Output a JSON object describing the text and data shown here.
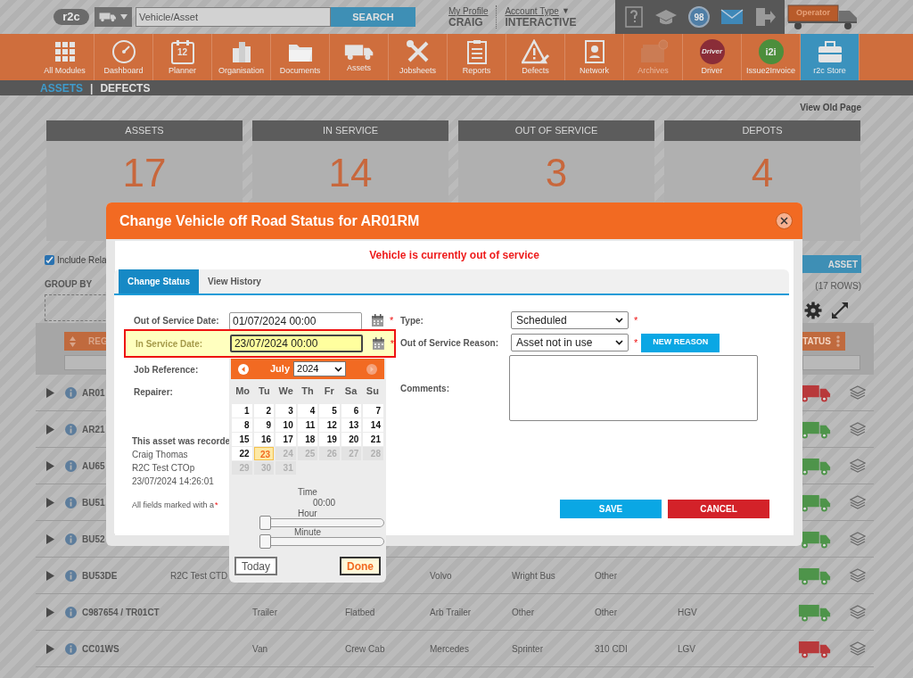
{
  "header": {
    "logo": "r2c",
    "search": {
      "placeholder": "Vehicle/Asset"
    },
    "search_button": "SEARCH",
    "profile": {
      "link": "My Profile",
      "name": "CRAIG"
    },
    "account": {
      "link": "Account Type",
      "caret": "▼",
      "value": "INTERACTIVE"
    },
    "tools": [
      {
        "kind": "help"
      },
      {
        "kind": "training"
      },
      {
        "kind": "badge",
        "text": "98"
      },
      {
        "kind": "mail"
      },
      {
        "kind": "logout"
      }
    ],
    "operator": "Operator"
  },
  "nav": [
    {
      "label": "All Modules",
      "kind": "grid",
      "selected": false,
      "disabled": false
    },
    {
      "label": "Dashboard",
      "kind": "gauge",
      "selected": false,
      "disabled": false
    },
    {
      "label": "Planner",
      "kind": "calendar",
      "icon_text": "12",
      "selected": false,
      "disabled": false
    },
    {
      "label": "Organisation",
      "kind": "building",
      "selected": false,
      "disabled": false
    },
    {
      "label": "Documents",
      "kind": "folder",
      "selected": false,
      "disabled": false
    },
    {
      "label": "Assets",
      "kind": "truck",
      "selected": false,
      "disabled": false
    },
    {
      "label": "Jobsheets",
      "kind": "tools",
      "selected": false,
      "disabled": false
    },
    {
      "label": "Reports",
      "kind": "clipboard",
      "selected": false,
      "disabled": false
    },
    {
      "label": "Defects",
      "kind": "warning",
      "selected": false,
      "disabled": false
    },
    {
      "label": "Network",
      "kind": "book",
      "selected": false,
      "disabled": false
    },
    {
      "label": "Archives",
      "kind": "archive",
      "selected": false,
      "disabled": true
    },
    {
      "label": "Driver",
      "kind": "driver",
      "icon_text": "Driver",
      "selected": false,
      "disabled": false
    },
    {
      "label": "Issue2Invoice",
      "kind": "i2i",
      "icon_text": "i2i",
      "selected": false,
      "disabled": false
    },
    {
      "label": "r2c Store",
      "kind": "store",
      "selected": true,
      "disabled": false
    }
  ],
  "subnav": {
    "items": [
      {
        "label": "ASSETS",
        "selected": true
      },
      {
        "label": "DEFECTS",
        "selected": false
      }
    ],
    "separator": "|"
  },
  "view_old_page": "View Old Page",
  "summary": [
    {
      "title": "ASSETS",
      "value": "17"
    },
    {
      "title": "IN SERVICE",
      "value": "14"
    },
    {
      "title": "OUT OF SERVICE",
      "value": "3"
    },
    {
      "title": "DEPOTS",
      "value": "4"
    }
  ],
  "toolbar": {
    "include": {
      "label": "Include Rela",
      "checked": true
    },
    "group_by": "GROUP BY",
    "add_button": "ASSET",
    "row_count": "(17 ROWS)"
  },
  "table": {
    "columns": [
      {
        "label": "REG"
      },
      {
        "label": "TATUS"
      }
    ],
    "rows": [
      {
        "reg": "AR01",
        "in_service": false
      },
      {
        "reg": "AR21",
        "in_service": true
      },
      {
        "reg": "AU65",
        "in_service": true
      },
      {
        "reg": "BU51",
        "in_service": true
      },
      {
        "reg": "BU52",
        "in_service": true
      },
      {
        "reg": "BU53DE",
        "owner": "R2C Test CTD",
        "make": "Volvo",
        "model": "Wright Bus",
        "variant": "Other",
        "in_service": true
      },
      {
        "reg": "C987654 / TR01CT",
        "type": "Trailer",
        "body": "Flatbed",
        "make": "Arb Trailer",
        "model": "Other",
        "variant": "Other",
        "category": "HGV",
        "in_service": true
      },
      {
        "reg": "CC01WS",
        "type": "Van",
        "body": "Crew Cab",
        "make": "Mercedes",
        "model": "Sprinter",
        "variant": "310 CDI",
        "category": "LGV",
        "in_service": false
      }
    ]
  },
  "modal": {
    "title": "Change Vehicle off Road Status for AR01RM",
    "notice": "Vehicle is currently out of service",
    "tabs": [
      {
        "label": "Change Status",
        "selected": true
      },
      {
        "label": "View History",
        "selected": false
      }
    ],
    "fields_left": [
      {
        "label": "Out of Service Date:",
        "kind": "date",
        "value": "01/07/2024 00:00",
        "required": "*",
        "highlighted": false
      },
      {
        "label": "In Service Date:",
        "kind": "date",
        "value": "23/07/2024 00:00",
        "required": "*",
        "highlighted": true
      },
      {
        "label": "Job Reference:",
        "kind": "label"
      },
      {
        "label": "Repairer:",
        "kind": "label"
      }
    ],
    "record_note": [
      "This asset was recorde",
      "Craig Thomas",
      "R2C Test CTOp",
      "23/07/2024 14:26:01"
    ],
    "required_note": {
      "text": "All fields marked with a",
      "mark": "*"
    },
    "fields_right": [
      {
        "label": "Type:",
        "kind": "select",
        "value": "Scheduled",
        "required": "*"
      },
      {
        "label": "Out of Service Reason:",
        "kind": "select",
        "value": "Asset not in use",
        "required": "*",
        "button": "NEW REASON"
      },
      {
        "label": "Comments:",
        "kind": "textarea"
      }
    ],
    "buttons": [
      {
        "label": "SAVE",
        "kind": "primary"
      },
      {
        "label": "CANCEL",
        "kind": "danger"
      }
    ]
  },
  "datepicker": {
    "month": "July",
    "year": "2024",
    "prev_disabled": false,
    "next_disabled": true,
    "weekdays": [
      "Mo",
      "Tu",
      "We",
      "Th",
      "Fr",
      "Sa",
      "Su"
    ],
    "days": [
      {
        "day": "1",
        "disabled": false,
        "selected": false
      },
      {
        "day": "2",
        "disabled": false,
        "selected": false
      },
      {
        "day": "3",
        "disabled": false,
        "selected": false
      },
      {
        "day": "4",
        "disabled": false,
        "selected": false
      },
      {
        "day": "5",
        "disabled": false,
        "selected": false
      },
      {
        "day": "6",
        "disabled": false,
        "selected": false
      },
      {
        "day": "7",
        "disabled": false,
        "selected": false
      },
      {
        "day": "8",
        "disabled": false,
        "selected": false
      },
      {
        "day": "9",
        "disabled": false,
        "selected": false
      },
      {
        "day": "10",
        "disabled": false,
        "selected": false
      },
      {
        "day": "11",
        "disabled": false,
        "selected": false
      },
      {
        "day": "12",
        "disabled": false,
        "selected": false
      },
      {
        "day": "13",
        "disabled": false,
        "selected": false
      },
      {
        "day": "14",
        "disabled": false,
        "selected": false
      },
      {
        "day": "15",
        "disabled": false,
        "selected": false
      },
      {
        "day": "16",
        "disabled": false,
        "selected": false
      },
      {
        "day": "17",
        "disabled": false,
        "selected": false
      },
      {
        "day": "18",
        "disabled": false,
        "selected": false
      },
      {
        "day": "19",
        "disabled": false,
        "selected": false
      },
      {
        "day": "20",
        "disabled": false,
        "selected": false
      },
      {
        "day": "21",
        "disabled": false,
        "selected": false
      },
      {
        "day": "22",
        "disabled": false,
        "selected": false
      },
      {
        "day": "23",
        "disabled": false,
        "selected": true
      },
      {
        "day": "24",
        "disabled": true,
        "selected": false
      },
      {
        "day": "25",
        "disabled": true,
        "selected": false
      },
      {
        "day": "26",
        "disabled": true,
        "selected": false
      },
      {
        "day": "27",
        "disabled": true,
        "selected": false
      },
      {
        "day": "28",
        "disabled": true,
        "selected": false
      },
      {
        "day": "29",
        "disabled": true,
        "selected": false
      },
      {
        "day": "30",
        "disabled": true,
        "selected": false
      },
      {
        "day": "31",
        "disabled": true,
        "selected": false
      }
    ],
    "time_label": "Time",
    "time": "00:00",
    "sliders": [
      {
        "label": "Hour",
        "level": 0
      },
      {
        "label": "Minute",
        "level": 0
      }
    ],
    "buttons": [
      {
        "label": "Today",
        "kind": "today"
      },
      {
        "label": "Done",
        "kind": "done"
      }
    ]
  }
}
